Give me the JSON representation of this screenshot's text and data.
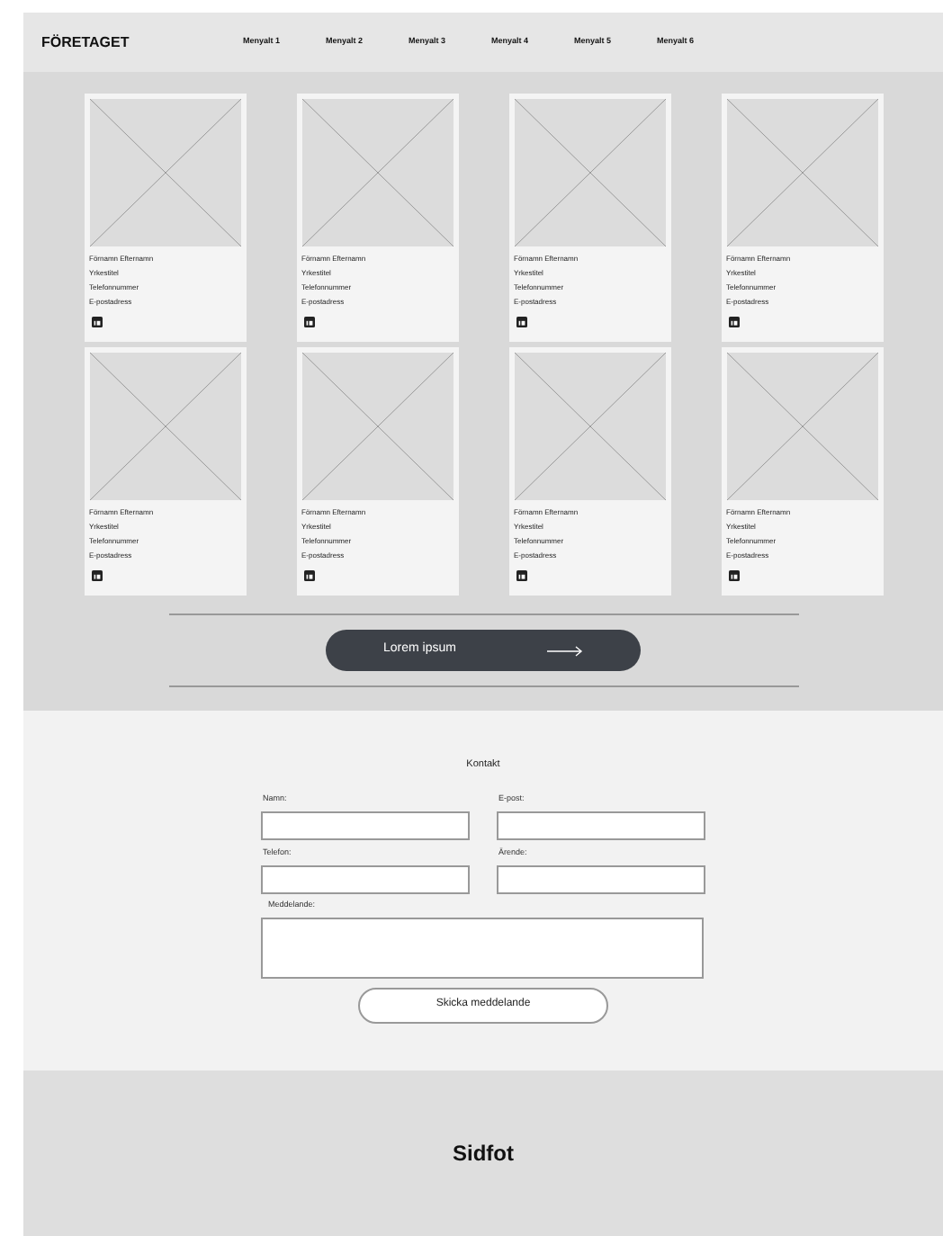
{
  "header": {
    "logo": "FÖRETAGET",
    "menu": [
      "Menyalt 1",
      "Menyalt 2",
      "Menyalt 3",
      "Menyalt 4",
      "Menyalt 5",
      "Menyalt 6"
    ]
  },
  "cards": [
    {
      "name": "Förnamn Efternamn",
      "title": "Yrkestitel",
      "phone": "Telefonnummer",
      "email": "E-postadress"
    },
    {
      "name": "Förnamn Efternamn",
      "title": "Yrkestitel",
      "phone": "Telefonnummer",
      "email": "E-postadress"
    },
    {
      "name": "Förnamn Efternamn",
      "title": "Yrkestitel",
      "phone": "Telefonnummer",
      "email": "E-postadress"
    },
    {
      "name": "Förnamn Efternamn",
      "title": "Yrkestitel",
      "phone": "Telefonnummer",
      "email": "E-postadress"
    },
    {
      "name": "Förnamn Efternamn",
      "title": "Yrkestitel",
      "phone": "Telefonnummer",
      "email": "E-postadress"
    },
    {
      "name": "Förnamn Efternamn",
      "title": "Yrkestitel",
      "phone": "Telefonnummer",
      "email": "E-postadress"
    },
    {
      "name": "Förnamn Efternamn",
      "title": "Yrkestitel",
      "phone": "Telefonnummer",
      "email": "E-postadress"
    },
    {
      "name": "Förnamn Efternamn",
      "title": "Yrkestitel",
      "phone": "Telefonnummer",
      "email": "E-postadress"
    }
  ],
  "cta_button": "Lorem ipsum",
  "contact": {
    "title": "Kontakt",
    "fields": [
      {
        "label": "Namn:"
      },
      {
        "label": "E-post:"
      },
      {
        "label": "Telefon:"
      },
      {
        "label": "Ärende:"
      }
    ],
    "message_label": "Meddelande:",
    "submit": "Skicka meddelande"
  },
  "footer": "Sidfot"
}
